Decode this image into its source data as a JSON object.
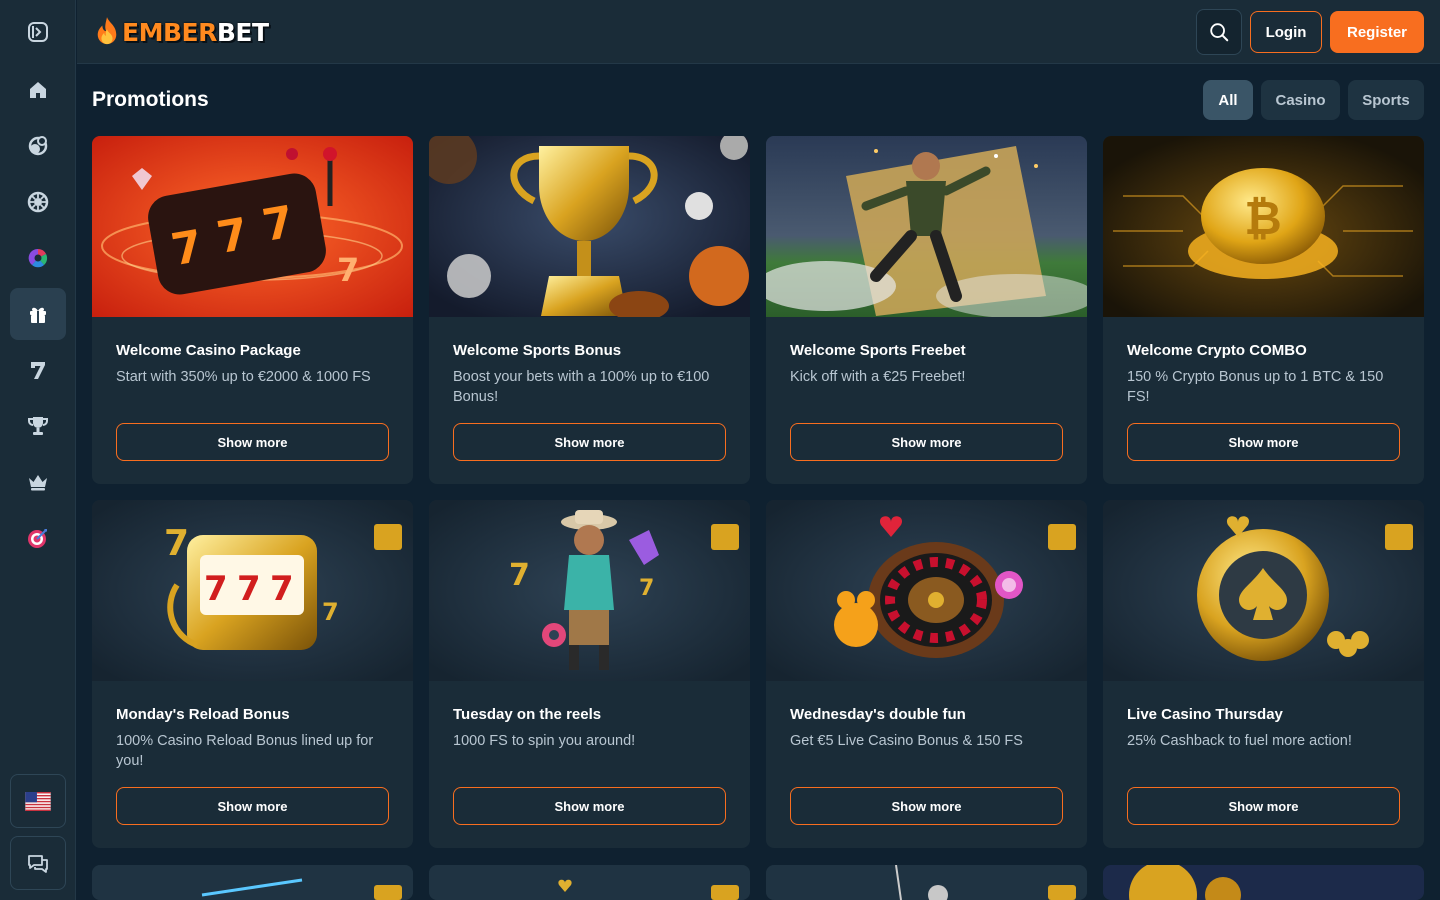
{
  "app": {
    "logo_prefix": "EMBER",
    "logo_suffix": "BET",
    "accent_color": "#f86e1f"
  },
  "header": {
    "search_icon": "search-icon",
    "login_label": "Login",
    "register_label": "Register"
  },
  "sidebar": {
    "items": [
      {
        "icon": "collapse-sidebar-icon"
      },
      {
        "icon": "home-icon"
      },
      {
        "icon": "sports-icon"
      },
      {
        "icon": "casino-icon"
      },
      {
        "icon": "live-icon"
      },
      {
        "icon": "gift-icon"
      },
      {
        "icon": "seven-icon"
      },
      {
        "icon": "trophy-icon"
      },
      {
        "icon": "crown-icon"
      },
      {
        "icon": "target-icon"
      }
    ],
    "language_icon": "us-flag-icon",
    "chat_icon": "chat-icon"
  },
  "promotions": {
    "title": "Promotions",
    "filters": [
      "All",
      "Casino",
      "Sports"
    ],
    "active_filter": "All",
    "show_more_label": "Show more",
    "cards": [
      {
        "title": "Welcome Casino Package",
        "desc": "Start with 350% up to €2000 & 1000 FS"
      },
      {
        "title": "Welcome Sports Bonus",
        "desc": "Boost your bets with a 100% up to €100 Bonus!"
      },
      {
        "title": "Welcome Sports Freebet",
        "desc": "Kick off with a €25 Freebet!"
      },
      {
        "title": "Welcome Crypto COMBO",
        "desc": "150 % Crypto Bonus up to 1 BTC & 150 FS!"
      },
      {
        "title": "Monday's Reload Bonus",
        "desc": "100% Casino Reload Bonus lined up for you!"
      },
      {
        "title": "Tuesday on the reels",
        "desc": "1000 FS to spin you around!"
      },
      {
        "title": "Wednesday's double fun",
        "desc": "Get €5 Live Casino Bonus & 150 FS"
      },
      {
        "title": "Live Casino Thursday",
        "desc": "25% Cashback to fuel more action!"
      }
    ]
  }
}
